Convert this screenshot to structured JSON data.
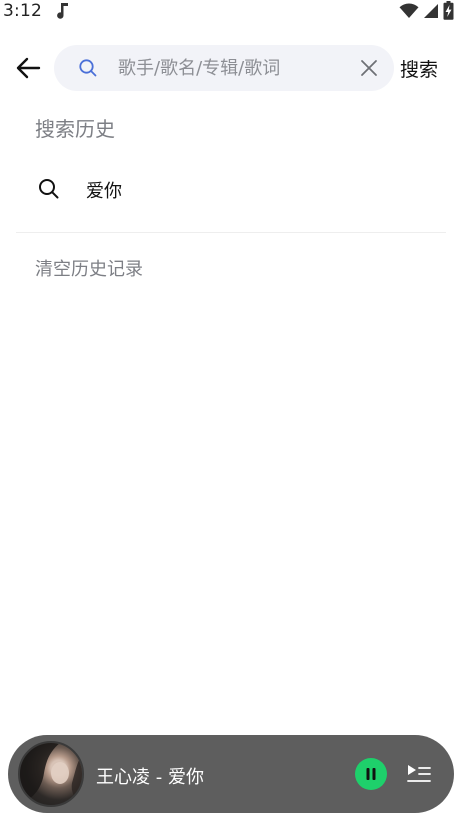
{
  "status_bar": {
    "time": "3:12",
    "icons": [
      "music-note-icon",
      "wifi-icon",
      "cellular-signal-icon",
      "battery-charging-icon"
    ]
  },
  "header": {
    "back_icon": "arrow-left-icon",
    "search_placeholder": "歌手/歌名/专辑/歌词",
    "search_value": "",
    "search_icon": "search-icon",
    "clear_icon": "close-icon",
    "submit_label": "搜索"
  },
  "history": {
    "title": "搜索历史",
    "items": [
      {
        "label": "爱你",
        "icon": "search-icon"
      }
    ],
    "clear_label": "清空历史记录"
  },
  "player": {
    "now_playing": "王心凌 - 爱你",
    "state": "playing",
    "accent_color": "#1ed06b",
    "play_pause_icon": "pause-icon",
    "playlist_icon": "playlist-icon"
  }
}
